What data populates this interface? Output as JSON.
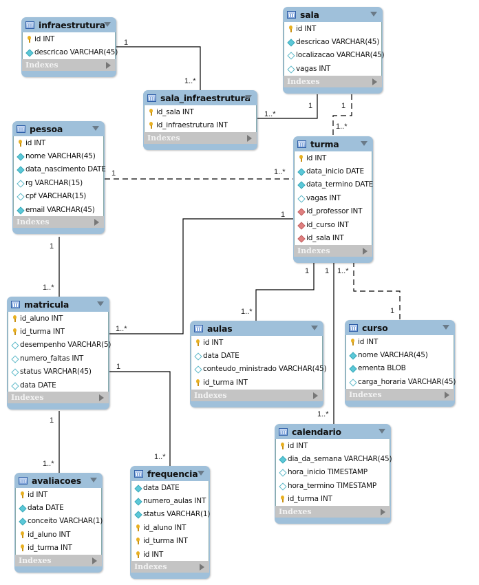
{
  "diagram": {
    "indexes_label": "Indexes",
    "tables": [
      {
        "key": "infraestrutura",
        "name": "infraestrutura",
        "columns": [
          {
            "name": "id INT",
            "kind": "pk"
          },
          {
            "name": "descricao VARCHAR(45)",
            "kind": "not-null"
          }
        ]
      },
      {
        "key": "sala",
        "name": "sala",
        "columns": [
          {
            "name": "id INT",
            "kind": "pk"
          },
          {
            "name": "descricao VARCHAR(45)",
            "kind": "not-null"
          },
          {
            "name": "localizacao VARCHAR(45)",
            "kind": "nullable"
          },
          {
            "name": "vagas INT",
            "kind": "nullable"
          }
        ]
      },
      {
        "key": "sala_infraestrutura",
        "name": "sala_infraestrutura",
        "columns": [
          {
            "name": "id_sala INT",
            "kind": "pk"
          },
          {
            "name": "id_infraestrutura INT",
            "kind": "pk"
          }
        ]
      },
      {
        "key": "pessoa",
        "name": "pessoa",
        "columns": [
          {
            "name": "id INT",
            "kind": "pk"
          },
          {
            "name": "nome VARCHAR(45)",
            "kind": "not-null"
          },
          {
            "name": "data_nascimento DATE",
            "kind": "not-null"
          },
          {
            "name": "rg VARCHAR(15)",
            "kind": "nullable"
          },
          {
            "name": "cpf VARCHAR(15)",
            "kind": "nullable"
          },
          {
            "name": "email VARCHAR(45)",
            "kind": "not-null"
          }
        ]
      },
      {
        "key": "turma",
        "name": "turma",
        "columns": [
          {
            "name": "id INT",
            "kind": "pk"
          },
          {
            "name": "data_inicio DATE",
            "kind": "not-null"
          },
          {
            "name": "data_termino DATE",
            "kind": "not-null"
          },
          {
            "name": "vagas INT",
            "kind": "nullable"
          },
          {
            "name": "id_professor INT",
            "kind": "fk"
          },
          {
            "name": "id_curso INT",
            "kind": "fk"
          },
          {
            "name": "id_sala INT",
            "kind": "fk"
          }
        ]
      },
      {
        "key": "matricula",
        "name": "matricula",
        "columns": [
          {
            "name": "id_aluno INT",
            "kind": "pk"
          },
          {
            "name": "id_turma INT",
            "kind": "pk"
          },
          {
            "name": "desempenho VARCHAR(5)",
            "kind": "nullable"
          },
          {
            "name": "numero_faltas INT",
            "kind": "nullable"
          },
          {
            "name": "status VARCHAR(45)",
            "kind": "nullable"
          },
          {
            "name": "data DATE",
            "kind": "nullable"
          }
        ]
      },
      {
        "key": "aulas",
        "name": "aulas",
        "columns": [
          {
            "name": "id INT",
            "kind": "pk"
          },
          {
            "name": "data DATE",
            "kind": "nullable"
          },
          {
            "name": "conteudo_ministrado VARCHAR(45)",
            "kind": "nullable"
          },
          {
            "name": "id_turma INT",
            "kind": "pk"
          }
        ]
      },
      {
        "key": "curso",
        "name": "curso",
        "columns": [
          {
            "name": "id INT",
            "kind": "pk"
          },
          {
            "name": "nome VARCHAR(45)",
            "kind": "not-null"
          },
          {
            "name": "ementa BLOB",
            "kind": "not-null"
          },
          {
            "name": "carga_horaria VARCHAR(45)",
            "kind": "nullable"
          }
        ]
      },
      {
        "key": "calendario",
        "name": "calendario",
        "columns": [
          {
            "name": "id INT",
            "kind": "pk"
          },
          {
            "name": "dia_da_semana VARCHAR(45)",
            "kind": "not-null"
          },
          {
            "name": "hora_inicio TIMESTAMP",
            "kind": "nullable"
          },
          {
            "name": "hora_termino TIMESTAMP",
            "kind": "nullable"
          },
          {
            "name": "id_turma INT",
            "kind": "pk"
          }
        ]
      },
      {
        "key": "avaliacoes",
        "name": "avaliacoes",
        "columns": [
          {
            "name": "id INT",
            "kind": "pk"
          },
          {
            "name": "data DATE",
            "kind": "not-null"
          },
          {
            "name": "conceito VARCHAR(1)",
            "kind": "not-null"
          },
          {
            "name": "id_aluno INT",
            "kind": "pk"
          },
          {
            "name": "id_turma INT",
            "kind": "pk"
          }
        ]
      },
      {
        "key": "frequencia",
        "name": "frequencia",
        "columns": [
          {
            "name": "data DATE",
            "kind": "not-null"
          },
          {
            "name": "numero_aulas INT",
            "kind": "not-null"
          },
          {
            "name": "status VARCHAR(1)",
            "kind": "not-null"
          },
          {
            "name": "id_aluno INT",
            "kind": "pk"
          },
          {
            "name": "id_turma INT",
            "kind": "pk"
          },
          {
            "name": "id INT",
            "kind": "pk"
          }
        ]
      }
    ],
    "relationships": [
      {
        "from": "infraestrutura",
        "to": "sala_infraestrutura",
        "from_card": "1",
        "to_card": "1..*",
        "style": "solid"
      },
      {
        "from": "sala",
        "to": "sala_infraestrutura",
        "from_card": "1",
        "to_card": "1..*",
        "style": "solid"
      },
      {
        "from": "sala",
        "to": "turma",
        "from_card": "1",
        "to_card": "1..*",
        "style": "dashed"
      },
      {
        "from": "pessoa",
        "to": "turma",
        "from_card": "1",
        "to_card": "1..*",
        "style": "dashed"
      },
      {
        "from": "pessoa",
        "to": "matricula",
        "from_card": "1",
        "to_card": "1..*",
        "style": "solid"
      },
      {
        "from": "turma",
        "to": "matricula",
        "from_card": "1",
        "to_card": "1..*",
        "style": "solid"
      },
      {
        "from": "turma",
        "to": "aulas",
        "from_card": "1",
        "to_card": "1..*",
        "style": "solid"
      },
      {
        "from": "turma",
        "to": "calendario",
        "from_card": "1",
        "to_card": "1..*",
        "style": "solid"
      },
      {
        "from": "curso",
        "to": "turma",
        "from_card": "1",
        "to_card": "1..*",
        "style": "dashed"
      },
      {
        "from": "matricula",
        "to": "avaliacoes",
        "from_card": "1",
        "to_card": "1..*",
        "style": "solid"
      },
      {
        "from": "matricula",
        "to": "frequencia",
        "from_card": "1",
        "to_card": "1..*",
        "style": "solid"
      }
    ]
  }
}
